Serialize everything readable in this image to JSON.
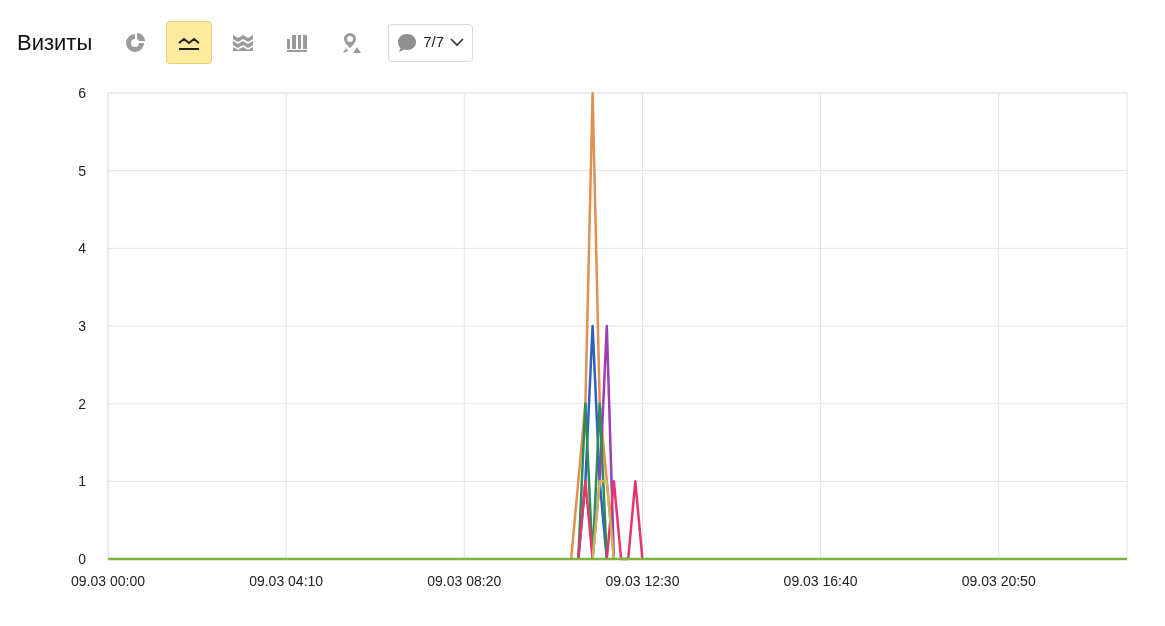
{
  "header": {
    "title": "Визиты",
    "view_buttons": [
      {
        "kind": "pie",
        "selected": false
      },
      {
        "kind": "line",
        "selected": true
      },
      {
        "kind": "area",
        "selected": false
      },
      {
        "kind": "bar",
        "selected": false
      },
      {
        "kind": "map",
        "selected": false
      }
    ],
    "series_filter": {
      "label": "7/7"
    }
  },
  "chart": {
    "chart_data": {
      "type": "line",
      "grid": true,
      "ylim": [
        0,
        6
      ],
      "yticks": [
        0,
        1,
        2,
        3,
        4,
        5,
        6
      ],
      "categories": [
        "09.03 00:00",
        null,
        null,
        null,
        null,
        null,
        null,
        null,
        null,
        null,
        null,
        null,
        null,
        null,
        null,
        null,
        null,
        null,
        null,
        null,
        null,
        null,
        null,
        null,
        null,
        "09.03 04:10",
        null,
        null,
        null,
        null,
        null,
        null,
        null,
        null,
        null,
        null,
        null,
        null,
        null,
        null,
        null,
        null,
        null,
        null,
        null,
        null,
        null,
        null,
        null,
        null,
        "09.03 08:20",
        null,
        null,
        null,
        null,
        null,
        null,
        null,
        null,
        null,
        null,
        null,
        null,
        null,
        null,
        null,
        null,
        null,
        null,
        null,
        null,
        null,
        null,
        null,
        null,
        "09.03 12:30",
        null,
        null,
        null,
        null,
        null,
        null,
        null,
        null,
        null,
        null,
        null,
        null,
        null,
        null,
        null,
        null,
        null,
        null,
        null,
        null,
        null,
        null,
        null,
        null,
        "09.03 16:40",
        null,
        null,
        null,
        null,
        null,
        null,
        null,
        null,
        null,
        null,
        null,
        null,
        null,
        null,
        null,
        null,
        null,
        null,
        null,
        null,
        null,
        null,
        null,
        null,
        "09.03 20:50",
        null,
        null,
        null,
        null,
        null,
        null,
        null,
        null,
        null,
        null,
        null,
        null,
        null,
        null,
        null,
        null,
        null,
        null
      ],
      "series": [
        {
          "color": "#e0904f",
          "values": [
            null,
            null,
            null,
            null,
            null,
            null,
            null,
            null,
            null,
            null,
            null,
            null,
            null,
            null,
            null,
            null,
            null,
            null,
            null,
            null,
            null,
            null,
            null,
            null,
            null,
            null,
            null,
            null,
            null,
            null,
            null,
            null,
            null,
            null,
            null,
            null,
            null,
            null,
            null,
            null,
            null,
            null,
            null,
            null,
            null,
            null,
            null,
            null,
            null,
            null,
            null,
            null,
            null,
            null,
            null,
            null,
            null,
            null,
            null,
            null,
            null,
            null,
            null,
            null,
            null,
            0,
            1,
            2,
            6,
            2,
            1,
            0,
            null,
            null,
            null,
            null,
            null,
            null,
            null,
            null,
            null,
            null,
            null,
            null,
            null,
            null,
            null,
            null,
            null,
            null,
            null,
            null,
            null,
            null,
            null,
            null,
            null,
            null,
            null,
            null,
            null,
            null,
            null,
            null,
            null,
            null,
            null,
            null,
            null,
            null,
            null,
            null,
            null,
            null,
            null,
            null,
            null,
            null,
            null,
            null,
            null,
            null,
            null,
            null,
            null,
            null,
            null,
            null,
            null,
            null,
            null,
            null,
            null,
            null,
            null,
            null,
            null,
            null,
            null,
            null,
            null,
            null,
            null,
            null
          ]
        },
        {
          "color": "#2f5fbf",
          "values": [
            null,
            null,
            null,
            null,
            null,
            null,
            null,
            null,
            null,
            null,
            null,
            null,
            null,
            null,
            null,
            null,
            null,
            null,
            null,
            null,
            null,
            null,
            null,
            null,
            null,
            null,
            null,
            null,
            null,
            null,
            null,
            null,
            null,
            null,
            null,
            null,
            null,
            null,
            null,
            null,
            null,
            null,
            null,
            null,
            null,
            null,
            null,
            null,
            null,
            null,
            null,
            null,
            null,
            null,
            null,
            null,
            null,
            null,
            null,
            null,
            null,
            null,
            null,
            null,
            null,
            null,
            0,
            1,
            3,
            1,
            0,
            null,
            null,
            null,
            null,
            null,
            null,
            null,
            null,
            null,
            null,
            null,
            null,
            null,
            null,
            null,
            null,
            null,
            null,
            null,
            null,
            null,
            null,
            null,
            null,
            null,
            null,
            null,
            null,
            null,
            null,
            null,
            null,
            null,
            null,
            null,
            null,
            null,
            null,
            null,
            null,
            null,
            null,
            null,
            null,
            null,
            null,
            null,
            null,
            null,
            null,
            null,
            null,
            null,
            null,
            null,
            null,
            null,
            null,
            null,
            null,
            null,
            null,
            null,
            null,
            null,
            null,
            null,
            null,
            null,
            null,
            null,
            null,
            null
          ]
        },
        {
          "color": "#9b3fb5",
          "values": [
            null,
            null,
            null,
            null,
            null,
            null,
            null,
            null,
            null,
            null,
            null,
            null,
            null,
            null,
            null,
            null,
            null,
            null,
            null,
            null,
            null,
            null,
            null,
            null,
            null,
            null,
            null,
            null,
            null,
            null,
            null,
            null,
            null,
            null,
            null,
            null,
            null,
            null,
            null,
            null,
            null,
            null,
            null,
            null,
            null,
            null,
            null,
            null,
            null,
            null,
            null,
            null,
            null,
            null,
            null,
            null,
            null,
            null,
            null,
            null,
            null,
            null,
            null,
            null,
            null,
            null,
            null,
            null,
            0,
            1,
            3,
            0,
            null,
            null,
            null,
            null,
            null,
            null,
            null,
            null,
            null,
            null,
            null,
            null,
            null,
            null,
            null,
            null,
            null,
            null,
            null,
            null,
            null,
            null,
            null,
            null,
            null,
            null,
            null,
            null,
            null,
            null,
            null,
            null,
            null,
            null,
            null,
            null,
            null,
            null,
            null,
            null,
            null,
            null,
            null,
            null,
            null,
            null,
            null,
            null,
            null,
            null,
            null,
            null,
            null,
            null,
            null,
            null,
            null,
            null,
            null,
            null,
            null,
            null,
            null,
            null,
            null,
            null,
            null,
            null,
            null,
            null,
            null,
            null
          ]
        },
        {
          "color": "#2e8b57",
          "values": [
            null,
            null,
            null,
            null,
            null,
            null,
            null,
            null,
            null,
            null,
            null,
            null,
            null,
            null,
            null,
            null,
            null,
            null,
            null,
            null,
            null,
            null,
            null,
            null,
            null,
            null,
            null,
            null,
            null,
            null,
            null,
            null,
            null,
            null,
            null,
            null,
            null,
            null,
            null,
            null,
            null,
            null,
            null,
            null,
            null,
            null,
            null,
            null,
            null,
            null,
            null,
            null,
            null,
            null,
            null,
            null,
            null,
            null,
            null,
            null,
            null,
            null,
            null,
            null,
            null,
            null,
            0,
            2,
            0,
            2,
            0,
            null,
            null,
            null,
            null,
            null,
            null,
            null,
            null,
            null,
            null,
            null,
            null,
            null,
            null,
            null,
            null,
            null,
            null,
            null,
            null,
            null,
            null,
            null,
            null,
            null,
            null,
            null,
            null,
            null,
            null,
            null,
            null,
            null,
            null,
            null,
            null,
            null,
            null,
            null,
            null,
            null,
            null,
            null,
            null,
            null,
            null,
            null,
            null,
            null,
            null,
            null,
            null,
            null,
            null,
            null,
            null,
            null,
            null,
            null,
            null,
            null,
            null,
            null,
            null,
            null,
            null,
            null,
            null,
            null,
            null,
            null,
            null,
            null
          ]
        },
        {
          "color": "#e8336d",
          "values": [
            null,
            null,
            null,
            null,
            null,
            null,
            null,
            null,
            null,
            null,
            null,
            null,
            null,
            null,
            null,
            null,
            null,
            null,
            null,
            null,
            null,
            null,
            null,
            null,
            null,
            null,
            null,
            null,
            null,
            null,
            null,
            null,
            null,
            null,
            null,
            null,
            null,
            null,
            null,
            null,
            null,
            null,
            null,
            null,
            null,
            null,
            null,
            null,
            null,
            null,
            null,
            null,
            null,
            null,
            null,
            null,
            null,
            null,
            null,
            null,
            null,
            null,
            null,
            null,
            null,
            null,
            0,
            1,
            0,
            null,
            0,
            1,
            0,
            0,
            1,
            0,
            null,
            null,
            null,
            null,
            null,
            null,
            null,
            null,
            null,
            null,
            null,
            null,
            null,
            null,
            null,
            null,
            null,
            null,
            null,
            null,
            null,
            null,
            null,
            null,
            null,
            null,
            null,
            null,
            null,
            null,
            null,
            null,
            null,
            null,
            null,
            null,
            null,
            null,
            null,
            null,
            null,
            null,
            null,
            null,
            null,
            null,
            null,
            null,
            null,
            null,
            null,
            null,
            null,
            null,
            null,
            null,
            null,
            null,
            null,
            null,
            null,
            null,
            null,
            null,
            null,
            null,
            null,
            null
          ]
        },
        {
          "color": "#c9b45a",
          "values": [
            null,
            null,
            null,
            null,
            null,
            null,
            null,
            null,
            null,
            null,
            null,
            null,
            null,
            null,
            null,
            null,
            null,
            null,
            null,
            null,
            null,
            null,
            null,
            null,
            null,
            null,
            null,
            null,
            null,
            null,
            null,
            null,
            null,
            null,
            null,
            null,
            null,
            null,
            null,
            null,
            null,
            null,
            null,
            null,
            null,
            null,
            null,
            null,
            null,
            null,
            null,
            null,
            null,
            null,
            null,
            null,
            null,
            null,
            null,
            null,
            null,
            null,
            null,
            null,
            null,
            null,
            null,
            null,
            0,
            1,
            1,
            0,
            null,
            null,
            null,
            null,
            null,
            null,
            null,
            null,
            null,
            null,
            null,
            null,
            null,
            null,
            null,
            null,
            null,
            null,
            null,
            null,
            null,
            null,
            null,
            null,
            null,
            null,
            null,
            null,
            null,
            null,
            null,
            null,
            null,
            null,
            null,
            null,
            null,
            null,
            null,
            null,
            null,
            null,
            null,
            null,
            null,
            null,
            null,
            null,
            null,
            null,
            null,
            null,
            null,
            null,
            null,
            null,
            null,
            null,
            null,
            null,
            null,
            null,
            null,
            null,
            null,
            null,
            null,
            null,
            null,
            null,
            null,
            null
          ]
        },
        {
          "color": "#7cb342",
          "values": [
            0,
            0,
            0,
            0,
            0,
            0,
            0,
            0,
            0,
            0,
            0,
            0,
            0,
            0,
            0,
            0,
            0,
            0,
            0,
            0,
            0,
            0,
            0,
            0,
            0,
            0,
            0,
            0,
            0,
            0,
            0,
            0,
            0,
            0,
            0,
            0,
            0,
            0,
            0,
            0,
            0,
            0,
            0,
            0,
            0,
            0,
            0,
            0,
            0,
            0,
            0,
            0,
            0,
            0,
            0,
            0,
            0,
            0,
            0,
            0,
            0,
            0,
            0,
            0,
            0,
            0,
            0,
            0,
            0,
            0,
            0,
            0,
            0,
            0,
            0,
            0,
            0,
            0,
            0,
            0,
            0,
            0,
            0,
            0,
            0,
            0,
            0,
            0,
            0,
            0,
            0,
            0,
            0,
            0,
            0,
            0,
            0,
            0,
            0,
            0,
            0,
            0,
            0,
            0,
            0,
            0,
            0,
            0,
            0,
            0,
            0,
            0,
            0,
            0,
            0,
            0,
            0,
            0,
            0,
            0,
            0,
            0,
            0,
            0,
            0,
            0,
            0,
            0,
            0,
            0,
            0,
            0,
            0,
            0,
            0,
            0,
            0,
            0,
            0,
            0,
            0,
            0,
            0,
            0
          ]
        }
      ]
    }
  }
}
